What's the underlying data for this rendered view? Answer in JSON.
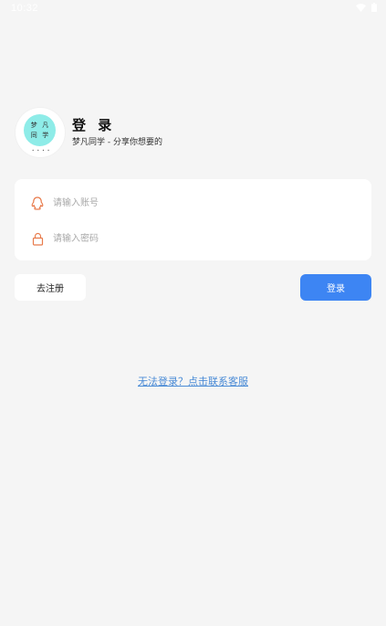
{
  "status_bar": {
    "time": "10:32",
    "icons": [
      "wifi-icon",
      "battery-icon"
    ]
  },
  "app": {
    "title": "登 录",
    "subtitle": "梦凡同学 - 分享你想要的",
    "logo_text": [
      "梦",
      "凡",
      "同",
      "学"
    ],
    "logo_caption": "• • • •"
  },
  "form": {
    "account_placeholder": "请输入账号",
    "account_value": "",
    "password_placeholder": "请输入密码",
    "password_value": ""
  },
  "buttons": {
    "register_label": "去注册",
    "login_label": "登录"
  },
  "help": {
    "link_text": "无法登录？点击联系客服"
  },
  "colors": {
    "background": "#f5f5f5",
    "primary": "#3d85f3",
    "icon_orange": "#e87b4c",
    "link": "#4a8bd6",
    "logo_teal": "#8eece8"
  }
}
